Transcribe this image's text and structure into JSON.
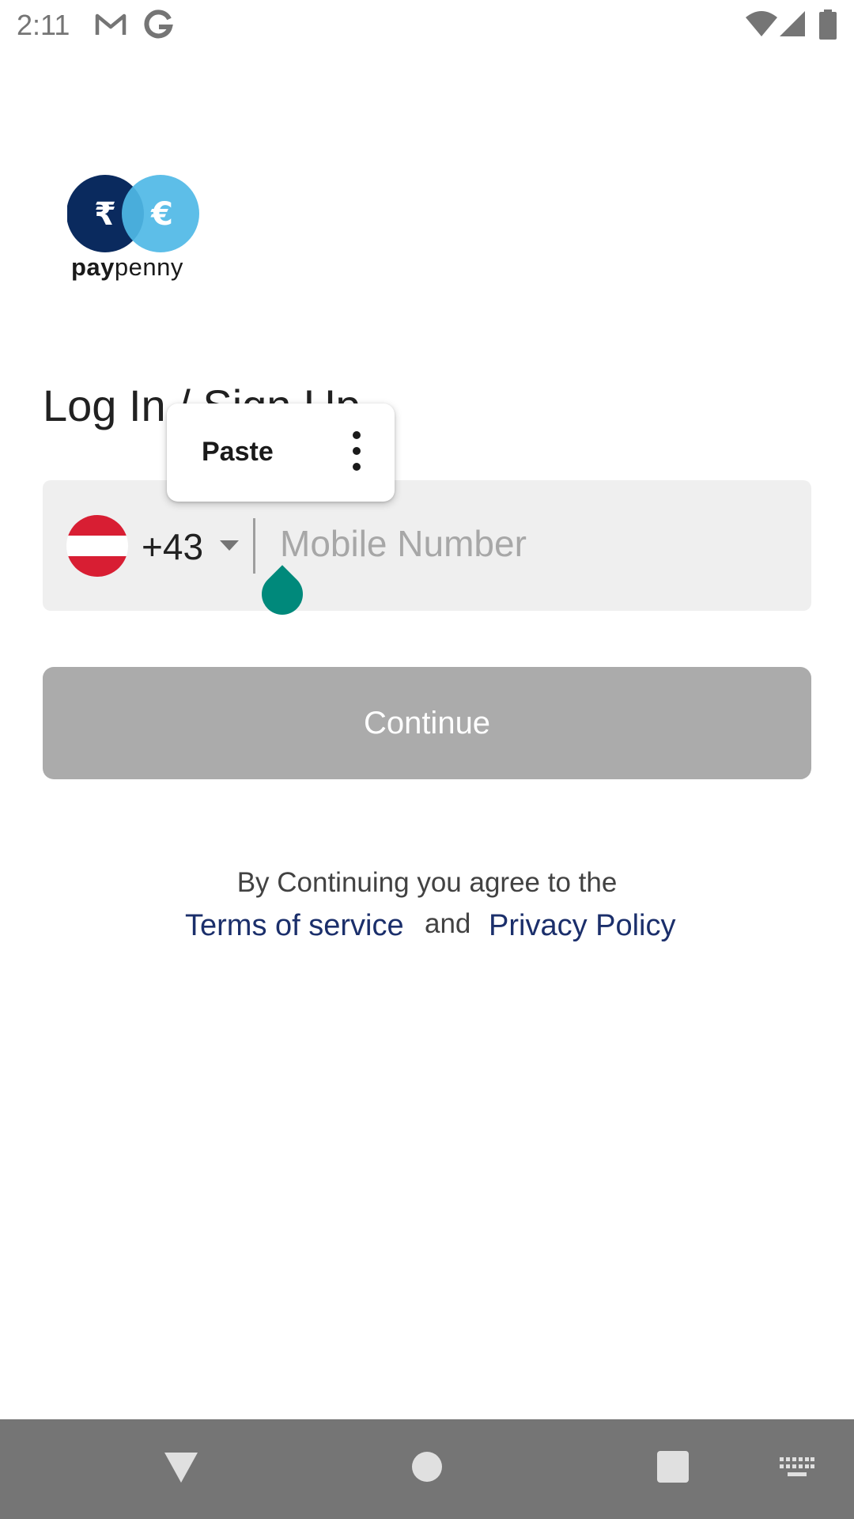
{
  "status_bar": {
    "time": "2:11",
    "icons": [
      "gmail-icon",
      "google-icon",
      "wifi-icon",
      "signal-icon",
      "battery-icon"
    ]
  },
  "logo": {
    "rupee_symbol": "₹",
    "euro_symbol": "€",
    "brand_bold": "pay",
    "brand_light": "penny",
    "colors": {
      "dark": "#0a2a5e",
      "light": "#4fb8e6"
    }
  },
  "title": "Log In / Sign Up",
  "phone_field": {
    "country_code": "+43",
    "flag": "austria-flag",
    "placeholder": "Mobile Number",
    "value": ""
  },
  "context_menu": {
    "paste_label": "Paste"
  },
  "continue_button": {
    "label": "Continue",
    "enabled": false
  },
  "terms": {
    "line1": "By Continuing you agree to the",
    "terms_link": "Terms of service",
    "and": "and",
    "privacy_link": "Privacy Policy"
  },
  "nav_bar": {
    "buttons": [
      "back-icon",
      "home-icon",
      "recents-icon",
      "keyboard-icon"
    ]
  },
  "colors": {
    "accent": "#00897b",
    "link": "#1b2f6b",
    "button_disabled": "#ababab",
    "field_bg": "#efefef"
  }
}
